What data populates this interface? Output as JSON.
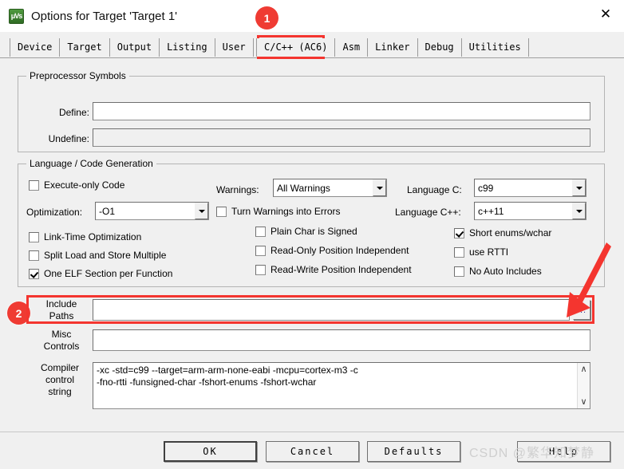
{
  "window": {
    "title": "Options for Target 'Target 1'",
    "icon": "uvision-icon",
    "icon_text": "μVs",
    "close_label": "✕"
  },
  "tabs": [
    {
      "label": "Device",
      "selected": false
    },
    {
      "label": "Target",
      "selected": false
    },
    {
      "label": "Output",
      "selected": false
    },
    {
      "label": "Listing",
      "selected": false
    },
    {
      "label": "User",
      "selected": false
    },
    {
      "label": "C/C++ (AC6)",
      "selected": true
    },
    {
      "label": "Asm",
      "selected": false
    },
    {
      "label": "Linker",
      "selected": false
    },
    {
      "label": "Debug",
      "selected": false
    },
    {
      "label": "Utilities",
      "selected": false
    }
  ],
  "preprocessor": {
    "legend": "Preprocessor Symbols",
    "define_label": "Define:",
    "define_value": "",
    "undefine_label": "Undefine:",
    "undefine_value": ""
  },
  "language": {
    "legend": "Language / Code Generation",
    "execute_only_code": "Execute-only Code",
    "optimization_label": "Optimization:",
    "optimization_value": "-O1",
    "link_time_optimization": "Link-Time Optimization",
    "split_load_store": "Split Load and Store Multiple",
    "one_elf_section": "One ELF Section per Function",
    "warnings_label": "Warnings:",
    "warnings_value": "All Warnings",
    "turn_warnings_into_errors": "Turn Warnings into Errors",
    "plain_char_is_signed": "Plain Char is Signed",
    "read_only_position_independent": "Read-Only Position Independent",
    "read_write_position_independent": "Read-Write Position Independent",
    "language_c_label": "Language C:",
    "language_c_value": "c99",
    "language_cpp_label": "Language C++:",
    "language_cpp_value": "c++11",
    "short_enums_wchar": "Short enums/wchar",
    "use_rtti": "use RTTI",
    "no_auto_includes": "No Auto Includes"
  },
  "paths": {
    "include_paths_label": "Include\nPaths",
    "include_paths_value": "",
    "include_browse_label": "...",
    "misc_controls_label": "Misc\nControls",
    "misc_controls_value": "",
    "compiler_control_label": "Compiler\ncontrol\nstring",
    "compiler_control_value": "-xc -std=c99 --target=arm-arm-none-eabi -mcpu=cortex-m3 -c\n-fno-rtti -funsigned-char -fshort-enums -fshort-wchar",
    "scroll_up": "∧",
    "scroll_down": "∨"
  },
  "footer": {
    "ok": "OK",
    "cancel": "Cancel",
    "defaults": "Defaults",
    "help": "Help"
  },
  "annotations": {
    "badge1": "1",
    "badge2": "2",
    "watermark": "CSDN @繁华知梦静",
    "accent_color": "#f4352f"
  }
}
